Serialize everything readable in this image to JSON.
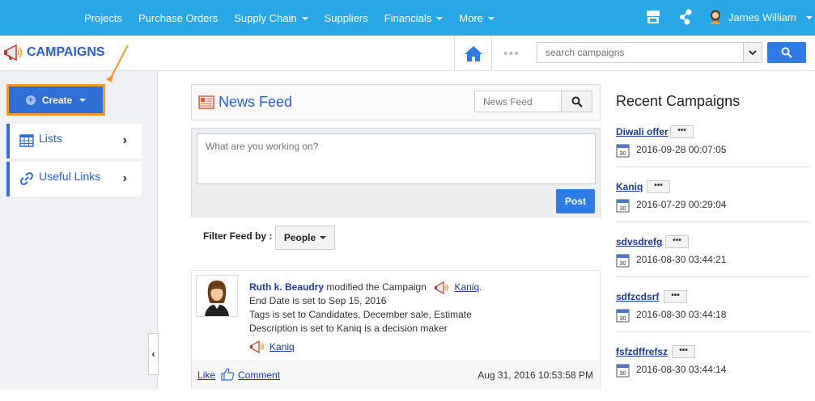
{
  "topnav": {
    "menu": [
      {
        "label": "Projects",
        "dropdown": false
      },
      {
        "label": "Purchase Orders",
        "dropdown": false
      },
      {
        "label": "Supply Chain",
        "dropdown": true
      },
      {
        "label": "Suppliers",
        "dropdown": false
      },
      {
        "label": "Financials",
        "dropdown": true
      },
      {
        "label": "More",
        "dropdown": true
      }
    ],
    "user_name": "James William",
    "bg_color": "#29a8e8"
  },
  "appbar": {
    "title": "CAMPAIGNS",
    "dots": "•••",
    "search_placeholder": "search campaigns"
  },
  "sidebar": {
    "create_label": "Create",
    "items": [
      {
        "label": "Lists",
        "icon": "table-icon"
      },
      {
        "label": "Useful Links",
        "icon": "link-icon"
      }
    ]
  },
  "feed": {
    "title": "News Feed",
    "search_placeholder": "News Feed",
    "post_placeholder": "What are you working on?",
    "post_label": "Post",
    "filter_label": "Filter Feed by :",
    "filter_value": "People",
    "item": {
      "author": "Ruth k. Beaudry",
      "action": "modified the Campaign",
      "campaign": "Kaniq",
      "campaign_suffix": ".",
      "lines": [
        "End Date is set to Sep 15, 2016",
        "Tags is set to Candidates, December sale, Estimate",
        "Description is set to Kaniq is a decision maker"
      ],
      "tag": "Kaniq",
      "like_label": "Like",
      "comment_label": "Comment",
      "timestamp": "Aug 31, 2016 10:53:58 PM"
    }
  },
  "recent": {
    "title": "Recent Campaigns",
    "more_label": "•••",
    "items": [
      {
        "name": "Diwali offer",
        "date": "2016-09-28 00:07:05"
      },
      {
        "name": "Kaniq",
        "date": "2016-07-29 00:29:04"
      },
      {
        "name": "sdvsdrefg",
        "date": "2016-08-30 03:44:21"
      },
      {
        "name": "sdfzcdsrf",
        "date": "2016-08-30 03:44:18"
      },
      {
        "name": "fsfzdffrefsz",
        "date": "2016-08-30 03:44:14"
      }
    ]
  },
  "colors": {
    "accent": "#2f7be5",
    "highlight": "#f29a2e",
    "title_blue": "#2a62c9"
  }
}
